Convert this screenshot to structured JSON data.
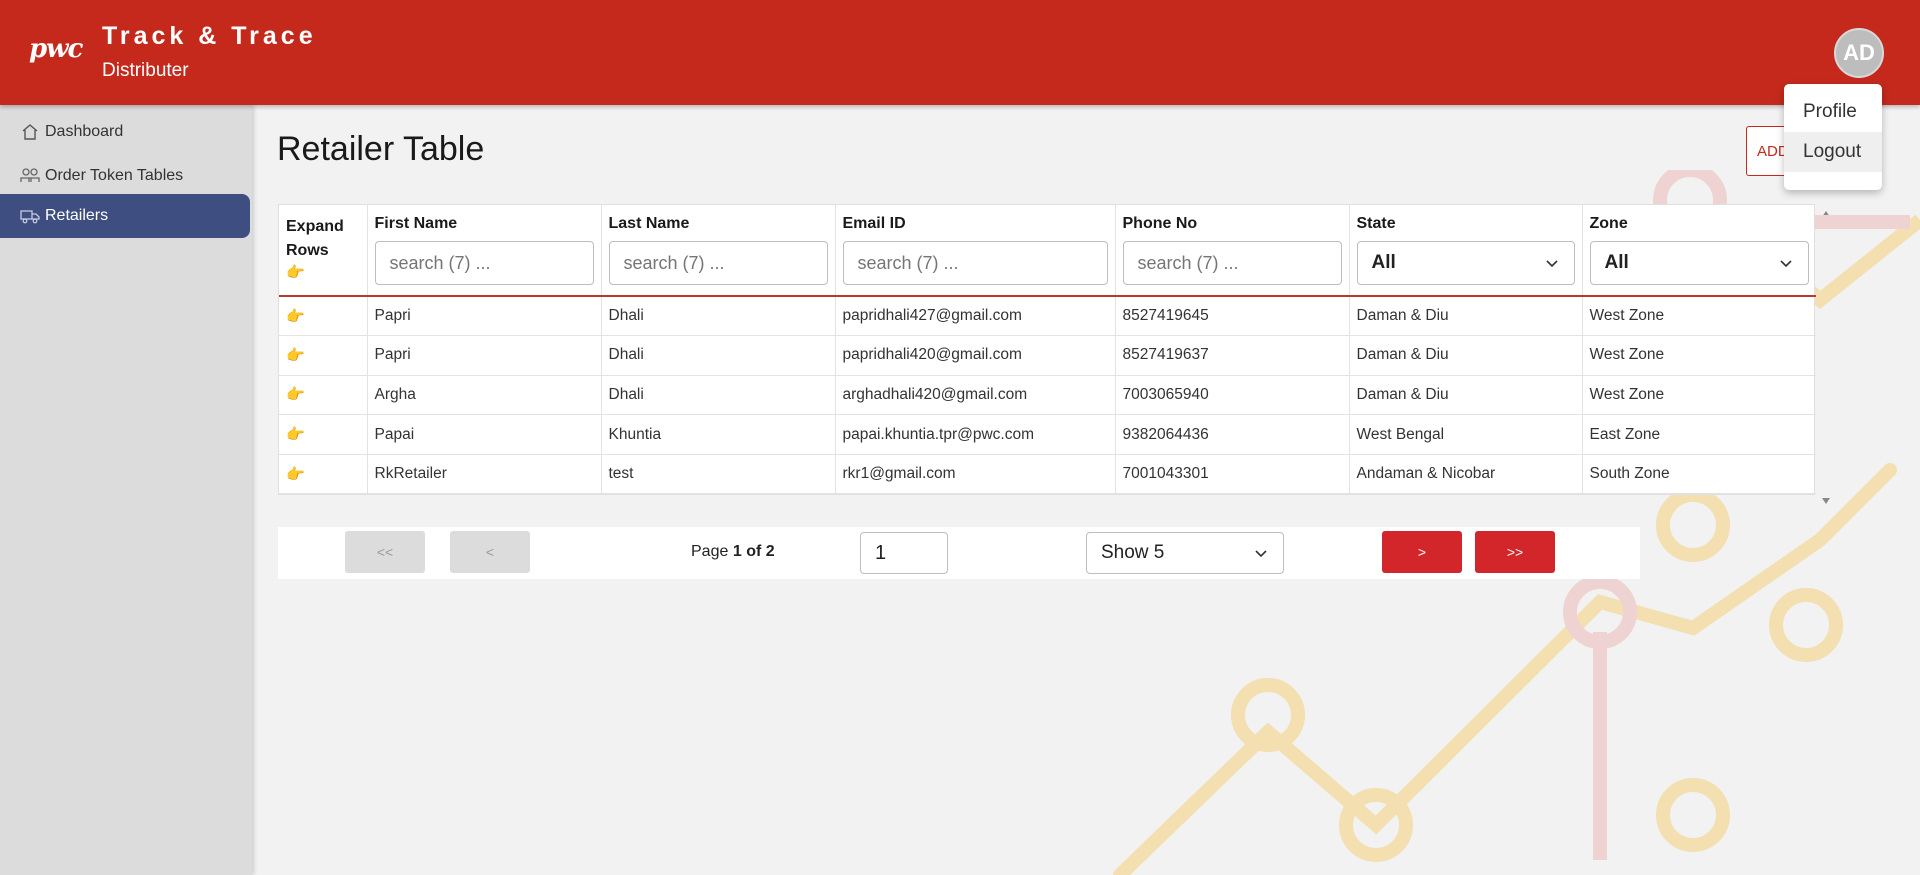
{
  "header": {
    "logo_text": "pwc",
    "app_title": "Track & Trace",
    "app_subtitle": "Distributer",
    "avatar_initials": "AD",
    "brand_color": "#c4291c"
  },
  "user_menu": {
    "items": [
      {
        "label": "Profile"
      },
      {
        "label": "Logout"
      }
    ]
  },
  "sidebar": {
    "items": [
      {
        "label": "Dashboard",
        "icon": "home-icon",
        "active": false
      },
      {
        "label": "Order Token Tables",
        "icon": "users-icon",
        "active": false
      },
      {
        "label": "Retailers",
        "icon": "truck-icon",
        "active": true
      }
    ],
    "active_color": "#3f4e81"
  },
  "main": {
    "page_title": "Retailer Table",
    "add_button_label": "ADD"
  },
  "table": {
    "expand_header_line1": "Expand",
    "expand_header_line2": "Rows",
    "columns": [
      {
        "label": "First Name",
        "filter_placeholder": "search (7) ..."
      },
      {
        "label": "Last Name",
        "filter_placeholder": "search (7) ..."
      },
      {
        "label": "Email ID",
        "filter_placeholder": "search (7) ..."
      },
      {
        "label": "Phone No",
        "filter_placeholder": "search (7) ..."
      },
      {
        "label": "State",
        "filter_value": "All"
      },
      {
        "label": "Zone",
        "filter_value": "All"
      }
    ],
    "rows": [
      [
        "Papri",
        "Dhali",
        "papridhali427@gmail.com",
        "8527419645",
        "Daman & Diu",
        "West Zone"
      ],
      [
        "Papri",
        "Dhali",
        "papridhali420@gmail.com",
        "8527419637",
        "Daman & Diu",
        "West Zone"
      ],
      [
        "Argha",
        "Dhali",
        "arghadhali420@gmail.com",
        "7003065940",
        "Daman & Diu",
        "West Zone"
      ],
      [
        "Papai",
        "Khuntia",
        "papai.khuntia.tpr@pwc.com",
        "9382064436",
        "West Bengal",
        "East Zone"
      ],
      [
        "RkRetailer",
        "test",
        "rkr1@gmail.com",
        "7001043301",
        "Andaman & Nicobar",
        "South Zone"
      ]
    ]
  },
  "pagination": {
    "first_label": "<<",
    "prev_label": "<",
    "next_label": ">",
    "last_label": ">>",
    "page_prefix": "Page",
    "current_page": "1",
    "of_label": "of",
    "total_pages": "2",
    "page_input_value": "1",
    "page_size_label": "Show 5",
    "button_color": "#d3262a"
  }
}
